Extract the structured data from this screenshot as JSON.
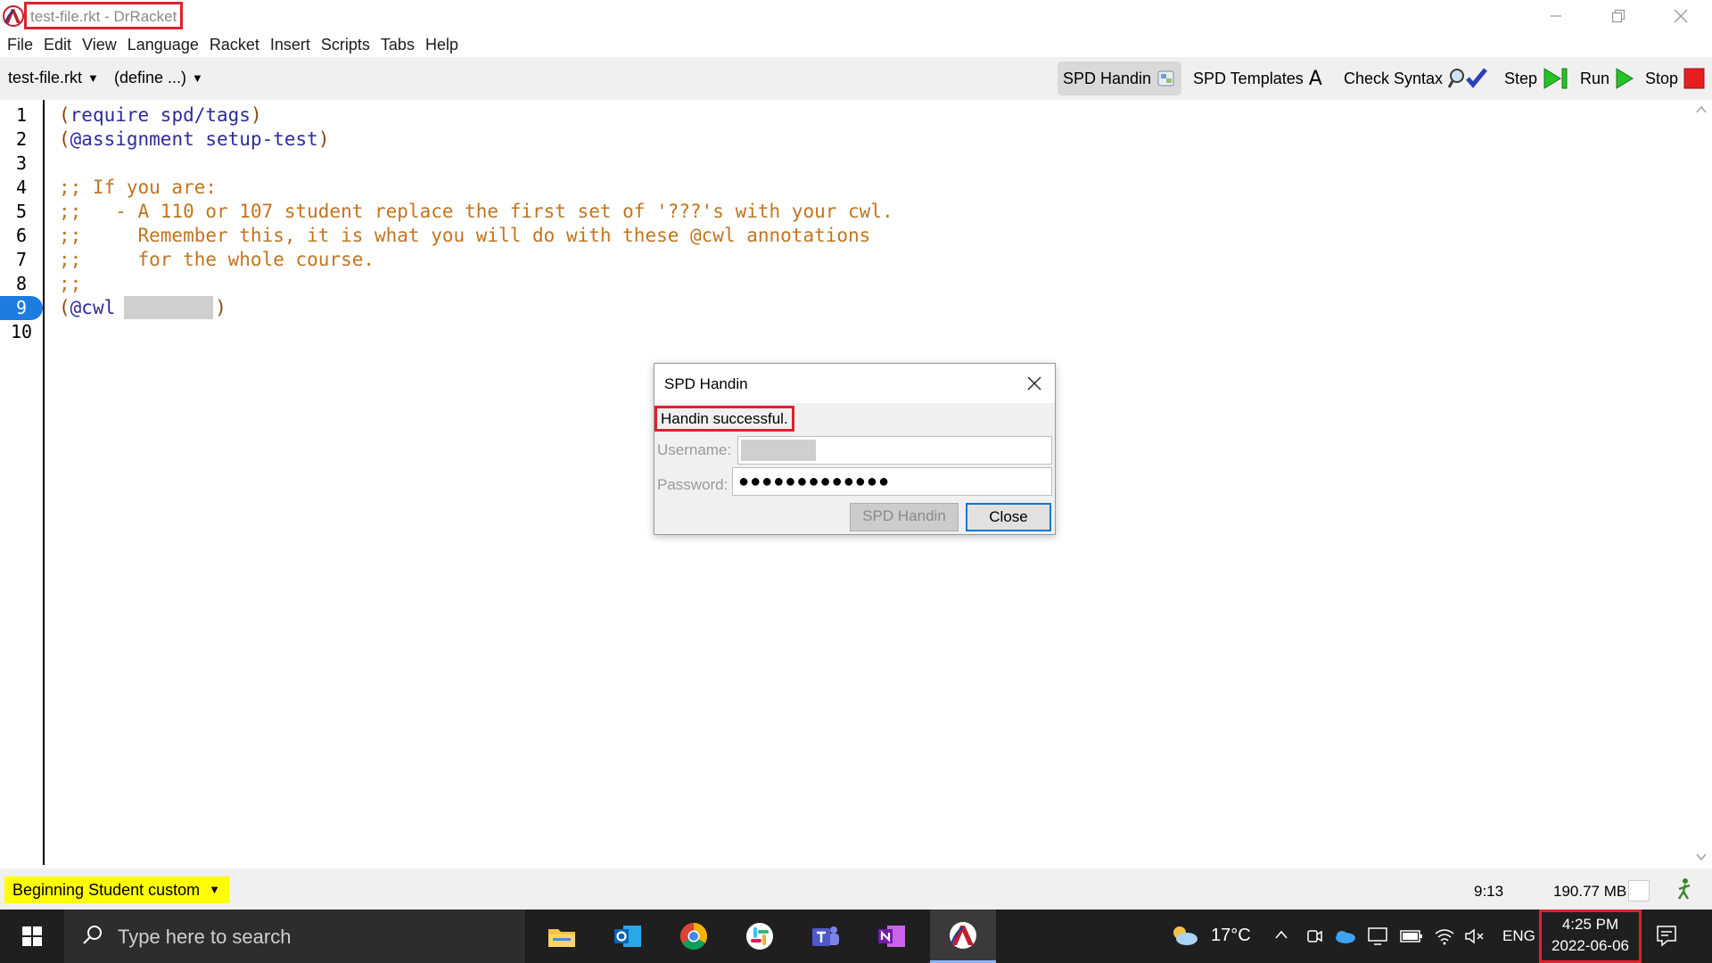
{
  "window": {
    "title": "test-file.rkt - DrRacket"
  },
  "menu": [
    "File",
    "Edit",
    "View",
    "Language",
    "Racket",
    "Insert",
    "Scripts",
    "Tabs",
    "Help"
  ],
  "toolbar": {
    "file_label": "test-file.rkt",
    "define_label": "(define ...)",
    "spd_handin": "SPD Handin",
    "spd_templates": "SPD Templates",
    "spd_templates_glyph": "A",
    "check_syntax": "Check Syntax",
    "step": "Step",
    "run": "Run",
    "stop": "Stop"
  },
  "editor": {
    "line_numbers": [
      "1",
      "2",
      "3",
      "4",
      "5",
      "6",
      "7",
      "8",
      "9",
      "10"
    ],
    "active_line": "9",
    "lines": {
      "l1_open": "(",
      "l1_sym": "require spd/tags",
      "l1_close": ")",
      "l2_open": "(",
      "l2_sym": "@assignment setup-test",
      "l2_close": ")",
      "l4": ";; If you are:",
      "l5": ";;   - A 110 or 107 student replace the first set of '???'s with your cwl.",
      "l6": ";;     Remember this, it is what you will do with these @cwl annotations",
      "l7": ";;     for the whole course.",
      "l8": ";;",
      "l9_open": "(",
      "l9_sym": "@cwl",
      "l9_close": ")"
    }
  },
  "statusbar": {
    "language": "Beginning Student custom",
    "cursor": "9:13",
    "memory": "190.77 MB"
  },
  "dialog": {
    "title": "SPD Handin",
    "status": "Handin successful.",
    "username_label": "Username:",
    "password_label": "Password:",
    "password_mask": "●●●●●●●●●●●●●",
    "handin_button": "SPD Handin",
    "close_button": "Close"
  },
  "taskbar": {
    "search_placeholder": "Type here to search",
    "temperature": "17°C",
    "language": "ENG",
    "time": "4:25 PM",
    "date": "2022-06-06"
  },
  "colors": {
    "highlight_red": "#e0202e",
    "comment": "#c2741f",
    "symbol": "#2c2c9c",
    "active_line": "#1e7be0",
    "language_bg": "#ffff00"
  }
}
